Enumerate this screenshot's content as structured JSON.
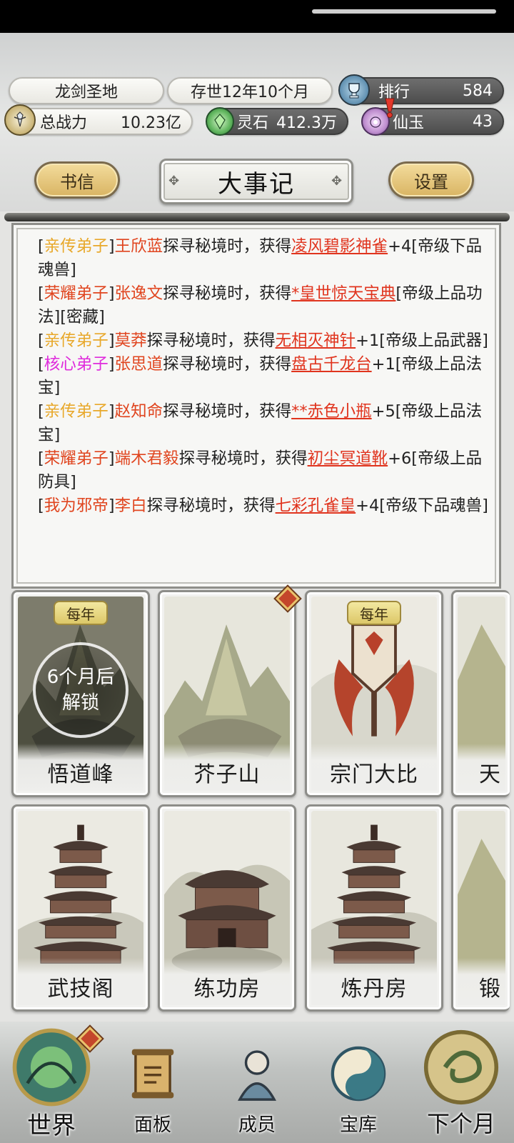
{
  "header": {
    "sect_name": "龙剑圣地",
    "age": "存世12年10个月",
    "rank_label": "排行",
    "rank_value": "584",
    "power_label": "总战力",
    "power_value": "10.23亿",
    "spirit_stone_label": "灵石",
    "spirit_stone_value": "412.3万",
    "jade_label": "仙玉",
    "jade_value": "43"
  },
  "toolbar": {
    "letters_label": "书信",
    "title": "大事记",
    "settings_label": "设置"
  },
  "log": [
    {
      "rank": "亲传弟子",
      "rank_color": "gold",
      "name": "王欣蓝",
      "mid": "探寻秘境时，获得",
      "item": "凌风碧影神雀",
      "tail": "+4[帝级下品魂兽]"
    },
    {
      "rank": "荣耀弟子",
      "rank_color": "red",
      "name": "张逸文",
      "mid": "探寻秘境时，获得",
      "item": "*皇世惊天宝典",
      "tail": "[帝级上品功法][密藏]"
    },
    {
      "rank": "亲传弟子",
      "rank_color": "gold",
      "name": "莫莽",
      "mid": "探寻秘境时，获得",
      "item": "无相灭神针",
      "tail": "+1[帝级上品武器]"
    },
    {
      "rank": "核心弟子",
      "rank_color": "pink",
      "name": "张思道",
      "mid": "探寻秘境时，获得",
      "item": "盘古千龙台",
      "tail": "+1[帝级上品法宝]"
    },
    {
      "rank": "亲传弟子",
      "rank_color": "gold",
      "name": "赵知命",
      "mid": "探寻秘境时，获得",
      "item": "**赤色小瓶",
      "tail": "+5[帝级上品法宝]"
    },
    {
      "rank": "荣耀弟子",
      "rank_color": "red",
      "name": "端木君毅",
      "mid": "探寻秘境时，获得",
      "item": "初尘冥道靴",
      "tail": "+6[帝级上品防具]"
    },
    {
      "rank": "我为邪帝",
      "rank_color": "red",
      "name": "李白",
      "mid": "探寻秘境时，获得",
      "item": "七彩孔雀皇",
      "tail": "+4[帝级下品魂兽]"
    }
  ],
  "locations_row1": [
    {
      "label": "悟道峰",
      "tag": "每年",
      "lock_line1": "6个月后",
      "lock_line2": "解锁"
    },
    {
      "label": "芥子山"
    },
    {
      "label": "宗门大比",
      "tag": "每年"
    },
    {
      "label": "天"
    }
  ],
  "locations_row2": [
    {
      "label": "武技阁"
    },
    {
      "label": "练功房"
    },
    {
      "label": "炼丹房"
    },
    {
      "label": "锻"
    }
  ],
  "nav": [
    {
      "label": "世界",
      "icon": "world-orb-icon"
    },
    {
      "label": "面板",
      "icon": "scroll-icon"
    },
    {
      "label": "成员",
      "icon": "member-figure-icon"
    },
    {
      "label": "宝库",
      "icon": "treasury-taiji-icon"
    },
    {
      "label": "下个月",
      "icon": "next-month-icon"
    }
  ],
  "colors": {
    "rank_gold": "#e8a82a",
    "rank_red": "#e0451f",
    "rank_pink": "#df2bdc",
    "item_red": "#e0341e"
  }
}
